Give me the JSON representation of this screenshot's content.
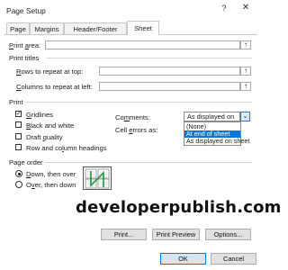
{
  "window": {
    "title": "Page Setup",
    "help_label": "?",
    "close_label": "✕"
  },
  "tabs": [
    {
      "label": "Page",
      "active": false
    },
    {
      "label": "Margins",
      "active": false
    },
    {
      "label": "Header/Footer",
      "active": false
    },
    {
      "label": "Sheet",
      "active": true
    }
  ],
  "print_area": {
    "label": "Print area:",
    "value": ""
  },
  "print_titles": {
    "section_label": "Print titles",
    "rows_label": "Rows to repeat at top:",
    "rows_value": "",
    "cols_label": "Columns to repeat at left:",
    "cols_value": ""
  },
  "print": {
    "section_label": "Print",
    "options": [
      {
        "label": "Gridlines",
        "checked": true
      },
      {
        "label": "Black and white",
        "checked": false
      },
      {
        "label": "Draft quality",
        "checked": false
      },
      {
        "label": "Row and column headings",
        "checked": false
      }
    ],
    "comments_label": "Comments:",
    "comments_value": "As displayed on sheet",
    "cell_errors_label": "Cell errors as:",
    "comments_dropdown": {
      "options": [
        "(None)",
        "At end of sheet",
        "As displayed on sheet"
      ],
      "selected_index": 1
    }
  },
  "page_order": {
    "section_label": "Page order",
    "options": [
      {
        "label": "Down, then over",
        "checked": true
      },
      {
        "label": "Over, then down",
        "checked": false
      }
    ]
  },
  "watermark": "developerpublish.com",
  "buttons": {
    "print": "Print...",
    "print_preview": "Print Preview",
    "options": "Options...",
    "ok": "OK",
    "cancel": "Cancel"
  },
  "icons": {
    "collapse_ref": "arrow-up-icon",
    "dropdown": "chevron-down-icon"
  }
}
